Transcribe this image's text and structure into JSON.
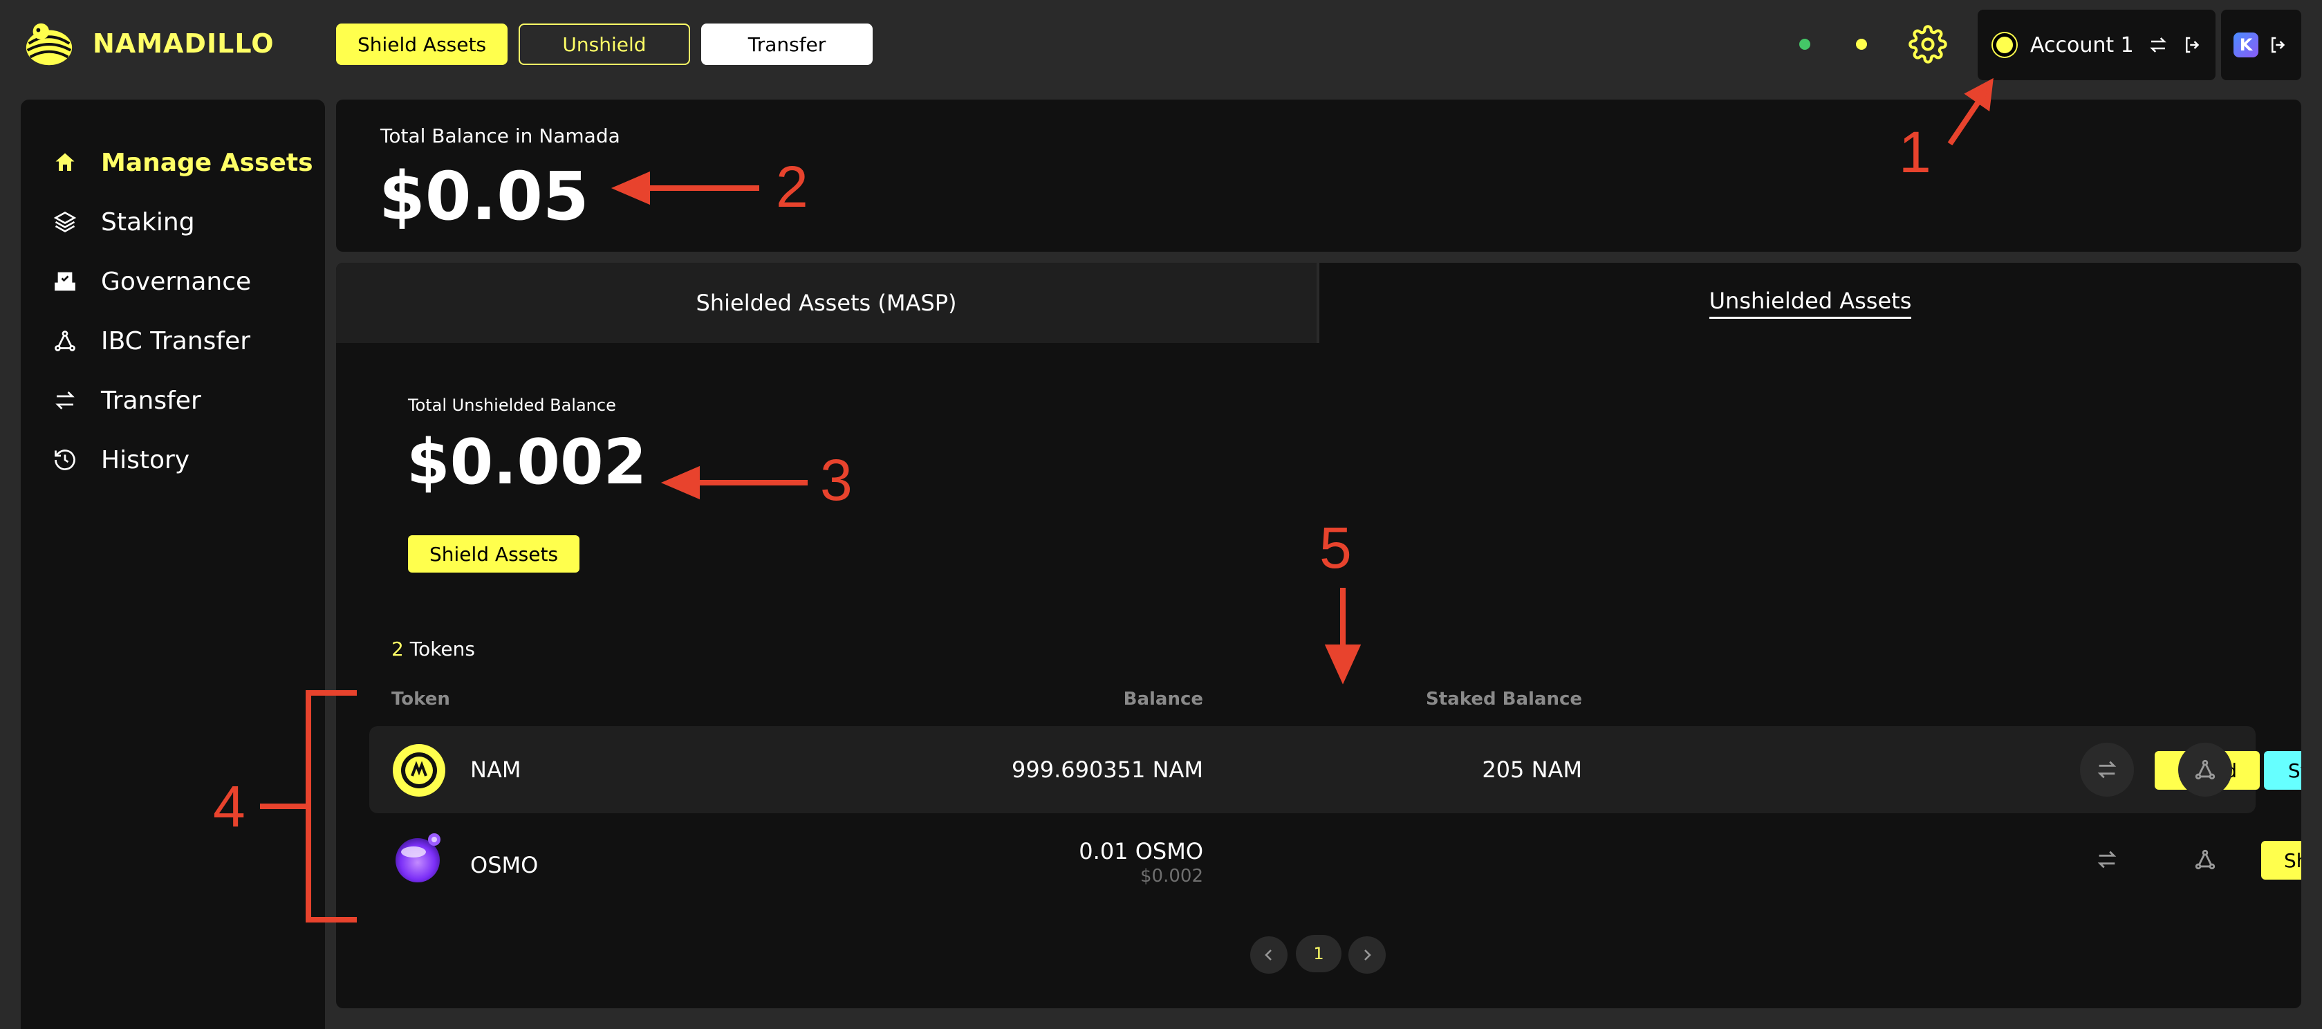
{
  "app": {
    "name": "NAMADILLO"
  },
  "top_nav": {
    "shield_label": "Shield Assets",
    "unshield_label": "Unshield",
    "transfer_label": "Transfer"
  },
  "account": {
    "label": "Account 1",
    "wallet_badge": "K"
  },
  "sidebar": {
    "items": [
      {
        "label": "Manage Assets",
        "icon": "home-icon",
        "active": true
      },
      {
        "label": "Staking",
        "icon": "layers-icon"
      },
      {
        "label": "Governance",
        "icon": "ballot-icon"
      },
      {
        "label": "IBC Transfer",
        "icon": "network-icon"
      },
      {
        "label": "Transfer",
        "icon": "arrows-icon"
      },
      {
        "label": "History",
        "icon": "history-icon"
      }
    ]
  },
  "total": {
    "label": "Total Balance in Namada",
    "value": "$0.05"
  },
  "tabs": {
    "shielded": "Shielded Assets (MASP)",
    "unshielded": "Unshielded Assets",
    "active": "unshielded"
  },
  "unshielded": {
    "label": "Total Unshielded Balance",
    "value": "$0.002",
    "shield_button": "Shield Assets"
  },
  "tokens": {
    "count": "2",
    "count_suffix": " Tokens",
    "headers": {
      "token": "Token",
      "balance": "Balance",
      "staked": "Staked Balance"
    },
    "rows": [
      {
        "name": "NAM",
        "balance": "999.690351 NAM",
        "staked": "205 NAM",
        "shield": "Shield",
        "stake": "Stake"
      },
      {
        "name": "OSMO",
        "balance": "0.01 OSMO",
        "balance_usd": "$0.002",
        "shield": "Shield"
      }
    ]
  },
  "pagination": {
    "current": "1"
  },
  "annotations": [
    "1",
    "2",
    "3",
    "4",
    "5"
  ],
  "colors": {
    "accent": "#ffff4d",
    "cyan": "#66ffff",
    "annotation": "#e8432d",
    "panel": "#111111",
    "background": "#2a2a2a"
  }
}
